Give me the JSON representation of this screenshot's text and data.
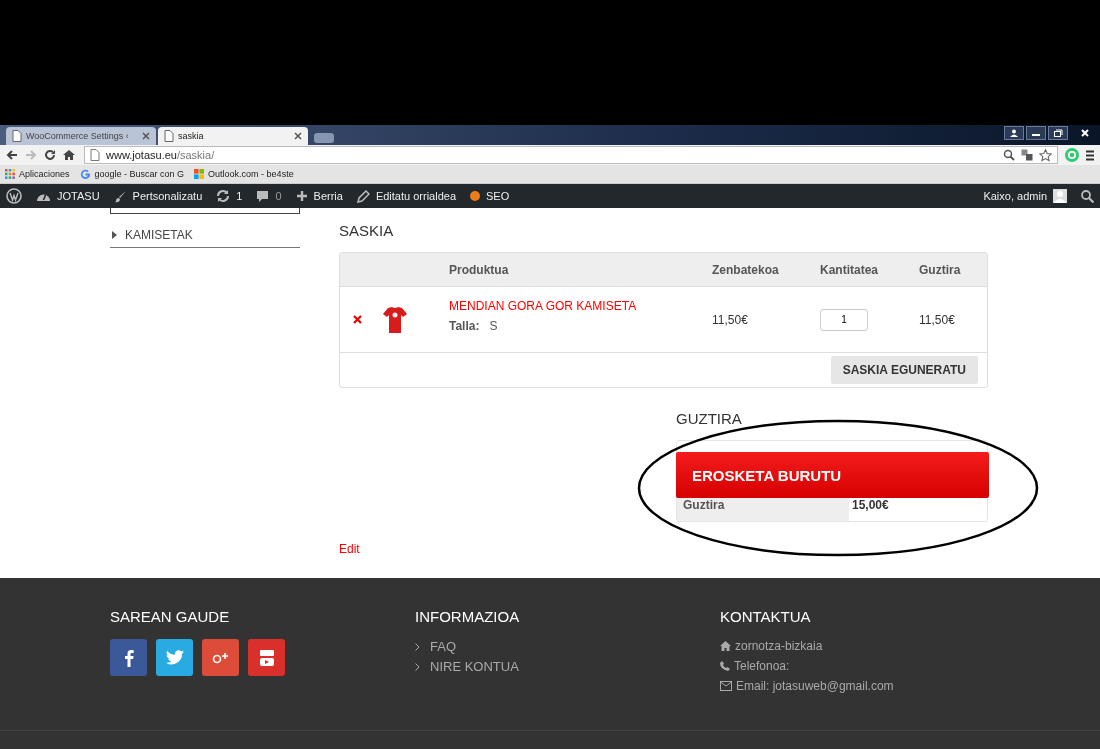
{
  "browser": {
    "tabs": [
      {
        "title": "WooCommerce Settings ‹",
        "selected": false
      },
      {
        "title": "saskia",
        "selected": true
      }
    ],
    "url": {
      "domain": "www.jotasu.eu",
      "path": "/saskia/"
    },
    "bookmarks": [
      {
        "kind": "apps",
        "label": "Aplicaciones"
      },
      {
        "kind": "google",
        "label": "google - Buscar con G"
      },
      {
        "kind": "windows",
        "label": "Outlook.com - be4ste"
      }
    ]
  },
  "admin_bar": {
    "items": [
      {
        "kind": "wp"
      },
      {
        "kind": "site",
        "label": "JOTASU"
      },
      {
        "kind": "brush",
        "label": "Pertsonalizatu"
      },
      {
        "kind": "updates",
        "label": "1"
      },
      {
        "kind": "comments",
        "label": "0"
      },
      {
        "kind": "new",
        "label": "Berria"
      },
      {
        "kind": "edit",
        "label": "Editatu orrialdea"
      },
      {
        "kind": "seo",
        "label": "SEO"
      }
    ],
    "greeting": "Kaixo, admin"
  },
  "sidebar": {
    "items": [
      "KAMISETAK"
    ]
  },
  "cart": {
    "title": "SASKIA",
    "columns": [
      "Produktua",
      "Zenbatekoa",
      "Kantitatea",
      "Guztira"
    ],
    "rows": [
      {
        "product": "MENDIAN GORA GOR KAMISETA",
        "attribute_label": "Talla:",
        "attribute_value": "S",
        "price": "11,50€",
        "quantity": "1",
        "subtotal": "11,50€"
      }
    ],
    "update_button": "SASKIA EGUNERATU"
  },
  "totals": {
    "title": "GUZTIRA",
    "rows": [
      {
        "label": "Guztira",
        "value": "15,00€"
      }
    ],
    "checkout_button": "EROSKETA BURUTU"
  },
  "edit_link": "Edit",
  "footer": {
    "social": {
      "title": "SAREAN GAUDE",
      "icons": [
        {
          "kind": "facebook",
          "color": "#3b5998"
        },
        {
          "kind": "twitter",
          "color": "#29aae1"
        },
        {
          "kind": "gplus",
          "color": "#dd4b39"
        },
        {
          "kind": "youtube",
          "color": "#d9302c"
        }
      ]
    },
    "info": {
      "title": "INFORMAZIOA",
      "links": [
        "FAQ",
        "NIRE KONTUA"
      ]
    },
    "contact": {
      "title": "KONTAKTUA",
      "lines": [
        {
          "kind": "home",
          "text": "zornotza-bizkaia"
        },
        {
          "kind": "phone",
          "text": "Telefonoa:"
        },
        {
          "kind": "mail",
          "text": "Email: jotasuweb@gmail.com"
        }
      ]
    }
  }
}
